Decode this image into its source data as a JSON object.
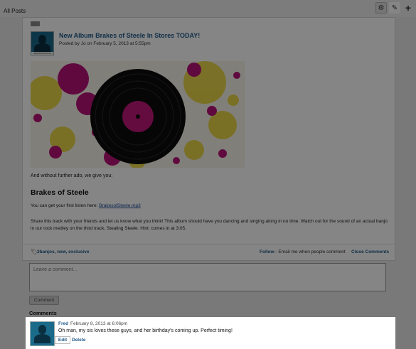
{
  "page": {
    "title": "All Posts"
  },
  "toolbar": {
    "gear_icon": "gear-icon",
    "edit_icon": "pencil-icon",
    "add_icon": "plus-icon"
  },
  "post": {
    "title": "New Album Brakes of Steele In Stores TODAY!",
    "meta": "Posted by Jo on February 5, 2013 at 5:55pm",
    "intro": "And without further ado, we give you:",
    "heading": "Brakes of Steele",
    "listen_prefix": "You can get your first listen here: ",
    "listen_link": "BrakesofSteele.mp3",
    "share_text": "Share this track with your friends and let us know what you think! This album should have you dancing and singing along in no time. Watch out for the sound of an actual banjo in our rock medley on the third track, Stealing Steele. Hint: comes in at 3:05.",
    "tags": "3banjos, new, exclusive",
    "follow_label": "Follow",
    "follow_desc": "– Email me when people comment",
    "close_comments_label": "Close Comments",
    "avatar_label": "ADMINISTRATOR"
  },
  "comment_form": {
    "placeholder": "Leave a comment...",
    "submit_label": "Comment"
  },
  "comments": {
    "heading": "Comments",
    "items": [
      {
        "author": "Fred",
        "date": "February 8, 2013 at 6:06pm",
        "text": "Oh man, my sis loves these guys, and her birthday's coming up. Perfect timing!",
        "edit_label": "Edit",
        "delete_label": "Delete"
      }
    ]
  },
  "colors": {
    "link": "#1f5a8a",
    "overlay": "rgba(0,0,0,0.48)",
    "record_label": "#c0177a",
    "splatter_pink": "#b8137a",
    "splatter_yellow": "#e8d43a"
  }
}
